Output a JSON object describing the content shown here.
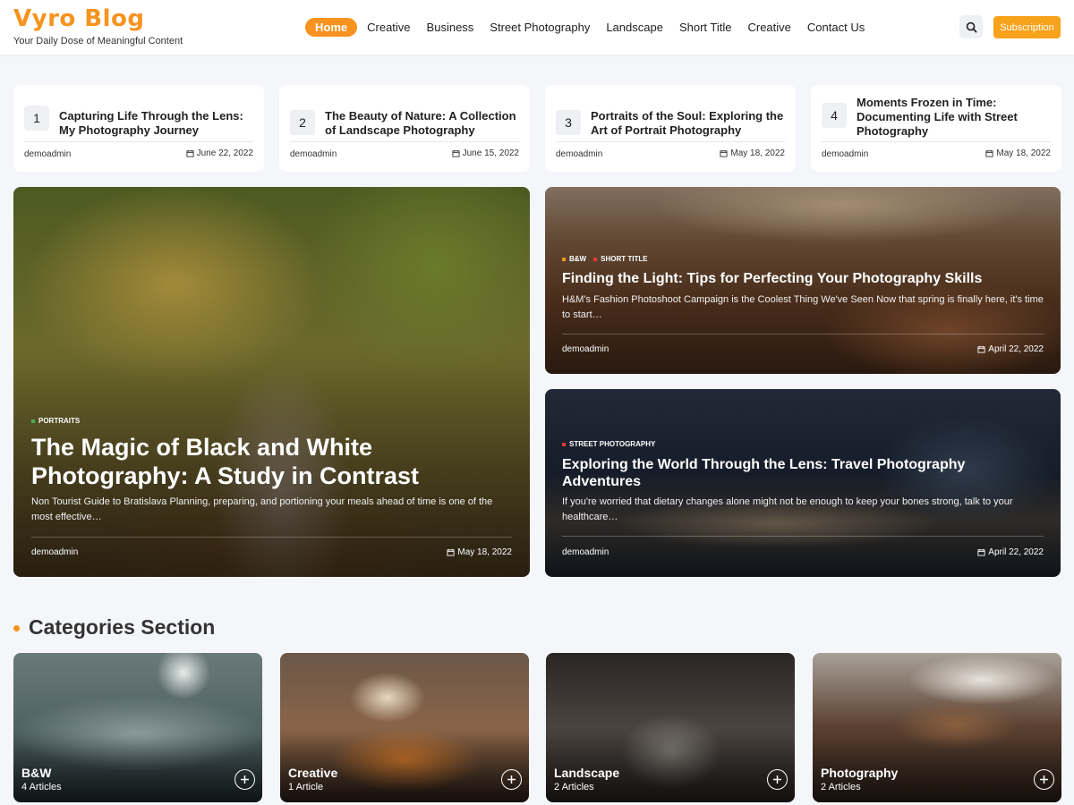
{
  "header": {
    "logo": "Vyro Blog",
    "tagline": "Your Daily Dose of Meaningful Content",
    "nav": [
      "Home",
      "Creative",
      "Business",
      "Street Photography",
      "Landscape",
      "Short Title",
      "Creative",
      "Contact Us"
    ],
    "search_icon": "search-icon",
    "subscription_label": "Subscription"
  },
  "numbered_posts": [
    {
      "num": "1",
      "title": "Capturing Life Through the Lens: My Photography Journey",
      "author": "demoadmin",
      "date": "June 22, 2022"
    },
    {
      "num": "2",
      "title": "The Beauty of Nature: A Collection of Landscape Photography",
      "author": "demoadmin",
      "date": "June 15, 2022"
    },
    {
      "num": "3",
      "title": "Portraits of the Soul: Exploring the Art of Portrait Photography",
      "author": "demoadmin",
      "date": "May 18, 2022"
    },
    {
      "num": "4",
      "title": "Moments Frozen in Time: Documenting Life with Street Photography",
      "author": "demoadmin",
      "date": "May 18, 2022"
    }
  ],
  "main_feature": {
    "tag": "PORTRAITS",
    "tag_color": "#4caf50",
    "title": "The Magic of Black and White Photography: A Study in Contrast",
    "excerpt": "Non Tourist Guide to Bratislava Planning, preparing, and portioning your meals ahead of time is one of the most effective…",
    "author": "demoadmin",
    "date": "May 18, 2022"
  },
  "side_features": [
    {
      "tags": [
        "B&W",
        "SHORT TITLE"
      ],
      "tag_colors": [
        "#f7931e",
        "#e53935"
      ],
      "title": "Finding the Light: Tips for Perfecting Your Photography Skills",
      "excerpt": "H&M's Fashion Photoshoot Campaign is the Coolest Thing We've Seen Now that spring is finally here, it's time to start…",
      "author": "demoadmin",
      "date": "April 22, 2022"
    },
    {
      "tags": [
        "STREET PHOTOGRAPHY"
      ],
      "tag_colors": [
        "#e53935"
      ],
      "title": "Exploring the World Through the Lens: Travel Photography Adventures",
      "excerpt": "If you're worried that dietary changes alone might not be enough to keep your bones strong, talk to your healthcare…",
      "author": "demoadmin",
      "date": "April 22, 2022"
    }
  ],
  "categories": {
    "heading": "Categories Section",
    "items": [
      {
        "name": "B&W",
        "count": "4 Articles"
      },
      {
        "name": "Creative",
        "count": "1 Article"
      },
      {
        "name": "Landscape",
        "count": "2 Articles"
      },
      {
        "name": "Photography",
        "count": "2 Articles"
      }
    ]
  },
  "colors": {
    "accent": "#f7931e",
    "background": "#f4f6f9"
  }
}
